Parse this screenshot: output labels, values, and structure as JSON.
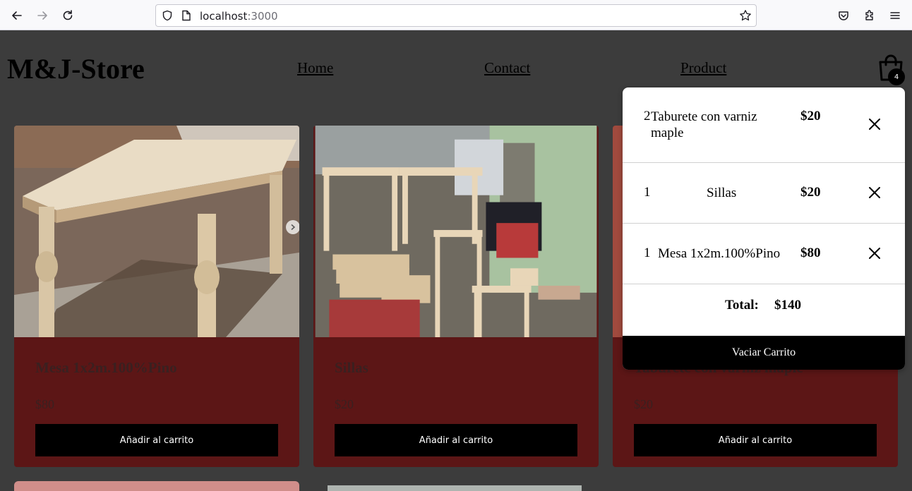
{
  "browser": {
    "url_host": "localhost",
    "url_port": ":3000"
  },
  "header": {
    "brand": "M&J-Store",
    "nav": [
      "Home",
      "Contact",
      "Product"
    ],
    "cart_count": "4"
  },
  "products": [
    {
      "title": "Mesa 1x2m.100%Pino",
      "price": "$80",
      "button": "Añadir al carrito"
    },
    {
      "title": "Sillas",
      "price": "$20",
      "button": "Añadir al carrito"
    },
    {
      "title": "Taburete con varniz maple",
      "price": "$20",
      "button": "Añadir al carrito"
    }
  ],
  "cart": {
    "items": [
      {
        "qty": "2",
        "name_line1": "Taburete con varniz",
        "name_line2": "maple",
        "price": "$20"
      },
      {
        "qty": "1",
        "name": "Sillas",
        "price": "$20"
      },
      {
        "qty": "1",
        "name": "Mesa 1x2m.100%Pino",
        "price": "$80"
      }
    ],
    "total_label": "Total:",
    "total_value": "$140",
    "clear_label": "Vaciar Carrito"
  }
}
